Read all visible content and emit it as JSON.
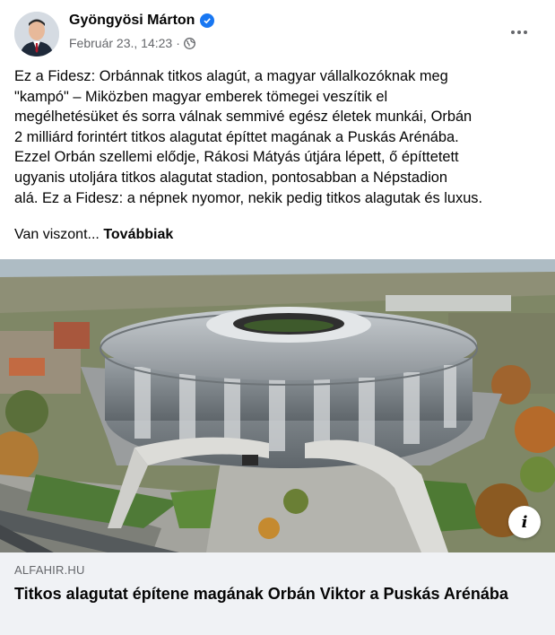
{
  "post": {
    "author": "Gyöngyösi Márton",
    "timestamp": "Február 23., 14:23",
    "separator": "·",
    "icons": {
      "verified": "verified-badge-icon",
      "audience": "globe-icon",
      "menu": "more-options-icon",
      "info": "info-icon"
    },
    "text_lines": [
      "Ez a Fidesz: Orbánnak titkos alagút, a magyar vállalkozóknak meg",
      "\"kampó\" – Miközben magyar emberek tömegei veszítik el",
      "megélhetésüket és sorra válnak semmivé egész életek munkái, Orbán",
      "2 milliárd forintért titkos alagutat építtet magának a Puskás Arénába.",
      "Ezzel Orbán szellemi elődje, Rákosi Mátyás útjára lépett, ő építtetett",
      "ugyanis utoljára titkos alagutat stadion, pontosabban a Népstadion",
      "alá. Ez a Fidesz: a népnek nyomor, nekik pedig titkos alagutak és luxus."
    ],
    "truncated_text": "Van viszont...",
    "see_more": "Továbbiak"
  },
  "link_preview": {
    "domain": "ALFAHIR.HU",
    "title": "Titkos alagutat építene magának Orbán Viktor a Puskás Arénába",
    "info_glyph": "i"
  },
  "colors": {
    "text": "#050505",
    "secondary": "#65676b",
    "verified": "#1877f2",
    "link_bg": "#f0f2f5"
  }
}
